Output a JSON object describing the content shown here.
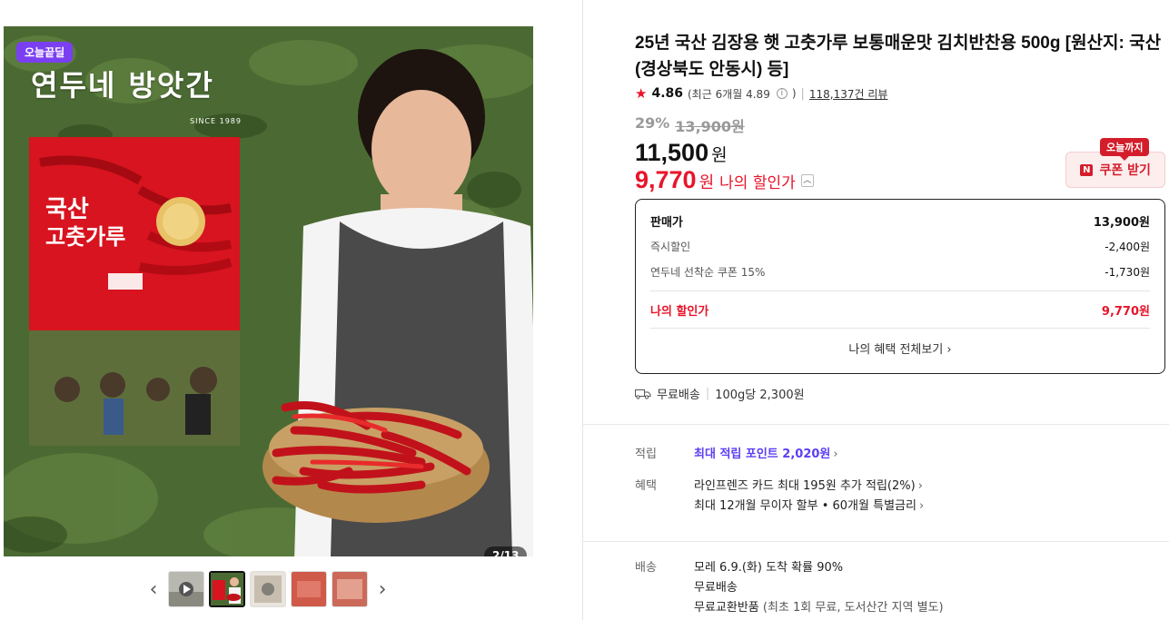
{
  "gallery": {
    "badge": "오늘끝딜",
    "brand_logo": "연두네 방앗간",
    "brand_since": "SINCE 1989",
    "counter": "2/13",
    "prev_icon": "chevron-left-icon",
    "next_icon": "chevron-right-icon",
    "play_icon": "play-icon"
  },
  "product": {
    "title": "25년 국산 김장용 햇 고춧가루 보통매운맛 김치반찬용 500g [원산지: 국산(경상북도 안동시) 등]",
    "rating": "4.86",
    "rating_recent": "(최근 6개월 4.89",
    "rating_recent_close": ")",
    "reviews": "118,137건 리뷰",
    "discount_rate": "29%",
    "original_price": "13,900원",
    "price": "11,500",
    "price_unit": "원",
    "my_price": "9,770",
    "my_price_unit": "원",
    "my_price_label": "나의 할인가"
  },
  "coupon": {
    "tooltip": "오늘까지",
    "n_label": "N",
    "button_label": "쿠폰 받기"
  },
  "benefit_box": {
    "rows": [
      {
        "label": "판매가",
        "value": "13,900원"
      },
      {
        "label": "즉시할인",
        "value": "-2,400원"
      },
      {
        "label": "연두네 선착순 쿠폰 15%",
        "value": "-1,730원"
      }
    ],
    "mine_label": "나의 할인가",
    "mine_value": "9,770원",
    "see_all": "나의 혜택 전체보기 ›"
  },
  "shipping": {
    "free": "무료배송",
    "unit_price": "100g당 2,300원"
  },
  "meta": {
    "points_label": "적립",
    "points_value": "최대 적립 포인트 2,020원",
    "benefit_label": "혜택",
    "benefit_line1": "라인프렌즈 카드 최대 195원 추가 적립(2%)",
    "benefit_line2": "최대 12개월 무이자 할부 • 60개월 특별금리",
    "delivery_label": "배송",
    "delivery_line1": "모레 6.9.(화) 도착 확률 90%",
    "delivery_line2": "무료배송",
    "delivery_line3_a": "무료교환반품",
    "delivery_line3_b": "(최초 1회 무료, 도서산간 지역 별도)"
  },
  "colors": {
    "accent_red": "#e8142a",
    "coupon_red": "#d41d2b",
    "badge_purple": "#7b3ff2",
    "points_purple": "#5b3ff2"
  }
}
